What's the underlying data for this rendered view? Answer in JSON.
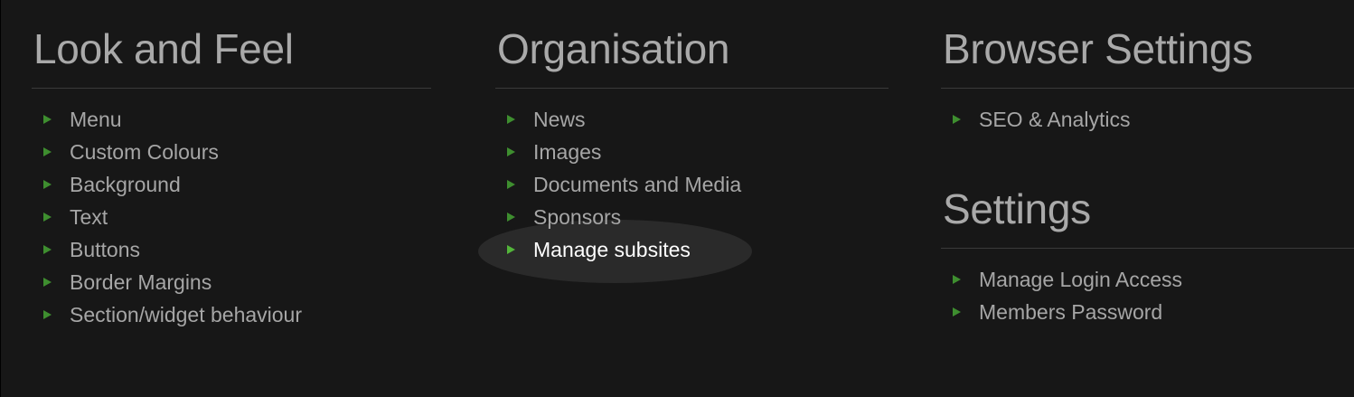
{
  "sections": {
    "look_and_feel": {
      "title": "Look and Feel",
      "items": [
        "Menu",
        "Custom Colours",
        "Background",
        "Text",
        "Buttons",
        "Border Margins",
        "Section/widget behaviour"
      ]
    },
    "organisation": {
      "title": "Organisation",
      "items": [
        "News",
        "Images",
        "Documents and Media",
        "Sponsors",
        "Manage subsites"
      ],
      "hovered_item": "Manage subsites"
    },
    "browser_settings": {
      "title": "Browser Settings",
      "items": [
        "SEO & Analytics"
      ]
    },
    "settings": {
      "title": "Settings",
      "items": [
        "Manage Login Access",
        "Members Password"
      ]
    }
  },
  "colors": {
    "background": "#171717",
    "text": "#a6a6a6",
    "heading": "#a9a9a9",
    "arrow": "#3e8e2f",
    "active_text": "#ffffff",
    "hover_highlight": "#2a2a2a"
  },
  "icons": {
    "bullet": "triangle-right-icon"
  }
}
